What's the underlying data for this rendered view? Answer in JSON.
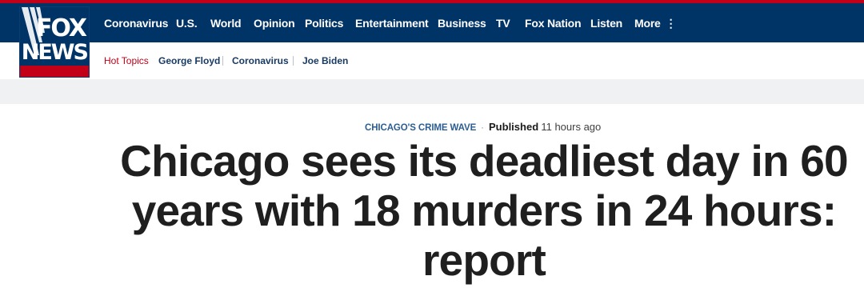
{
  "logo": {
    "line1": "FOX",
    "line2": "NEWS"
  },
  "nav": {
    "items": [
      "Coronavirus",
      "U.S.",
      "World",
      "Opinion",
      "Politics",
      "Entertainment",
      "Business",
      "TV",
      "Fox Nation",
      "Listen",
      "More"
    ],
    "more_icon": "vertical-ellipsis-icon"
  },
  "hot_topics": {
    "label": "Hot Topics",
    "items": [
      "George Floyd",
      "Coronavirus",
      "Joe Biden"
    ]
  },
  "article": {
    "category": "CHICAGO'S CRIME WAVE",
    "separator": "·",
    "published_label": "Published",
    "published_time": "11 hours ago",
    "headline": "Chicago sees its deadliest day in 60 years with 18 murders in 24 hours: report"
  },
  "colors": {
    "brand_navy": "#003366",
    "brand_red": "#c20017",
    "category_blue": "#2b5d93",
    "headline": "#1f1f1f"
  }
}
